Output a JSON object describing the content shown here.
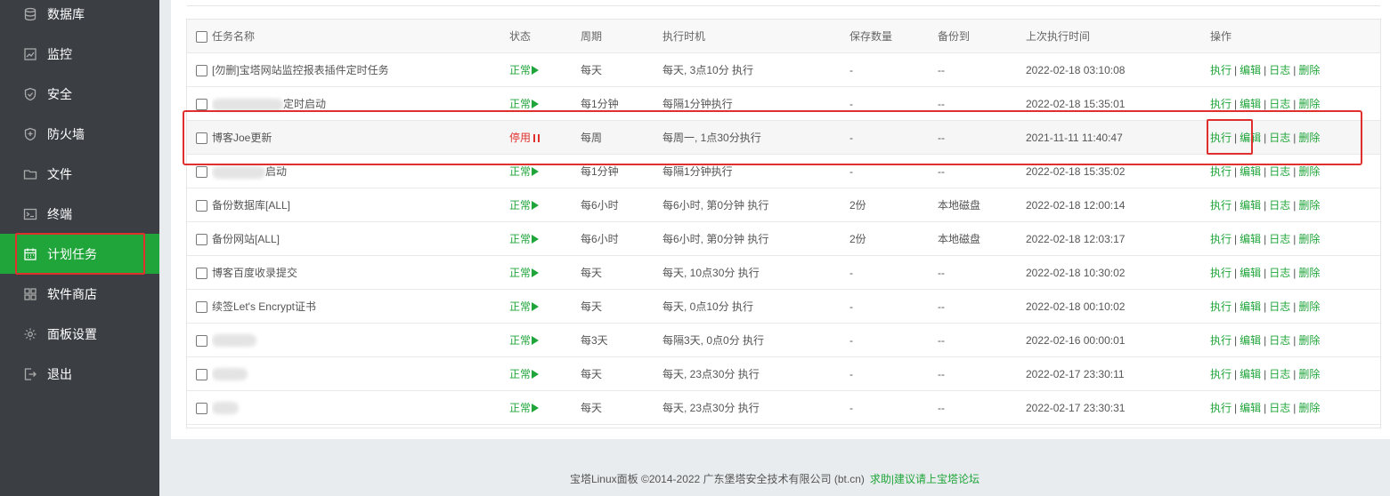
{
  "sidebar": {
    "items": [
      {
        "label": "数据库",
        "icon": "database-icon"
      },
      {
        "label": "监控",
        "icon": "monitor-icon"
      },
      {
        "label": "安全",
        "icon": "shield-icon"
      },
      {
        "label": "防火墙",
        "icon": "firewall-icon"
      },
      {
        "label": "文件",
        "icon": "folder-icon"
      },
      {
        "label": "终端",
        "icon": "terminal-icon"
      },
      {
        "label": "计划任务",
        "icon": "calendar-icon",
        "active": true
      },
      {
        "label": "软件商店",
        "icon": "apps-icon"
      },
      {
        "label": "面板设置",
        "icon": "gear-icon"
      },
      {
        "label": "退出",
        "icon": "logout-icon"
      }
    ]
  },
  "table": {
    "headers": {
      "name": "任务名称",
      "status": "状态",
      "cycle": "周期",
      "time": "执行时机",
      "keep": "保存数量",
      "backup": "备份到",
      "last": "上次执行时间",
      "ops": "操作"
    },
    "rows": [
      {
        "name": "[勿删]宝塔网站监控报表插件定时任务",
        "status": "正常",
        "cycle": "每天",
        "time": "每天, 3点10分 执行",
        "keep": "-",
        "backup": "--",
        "last": "2022-02-18 03:10:08"
      },
      {
        "name": "定时启动",
        "status": "正常",
        "cycle": "每1分钟",
        "time": "每隔1分钟执行",
        "keep": "-",
        "backup": "--",
        "last": "2022-02-18 15:35:01"
      },
      {
        "name": "博客Joe更新",
        "status": "停用",
        "cycle": "每周",
        "time": "每周一, 1点30分执行",
        "keep": "-",
        "backup": "--",
        "last": "2021-11-11 11:40:47"
      },
      {
        "name": "启动",
        "status": "正常",
        "cycle": "每1分钟",
        "time": "每隔1分钟执行",
        "keep": "-",
        "backup": "--",
        "last": "2022-02-18 15:35:02"
      },
      {
        "name": "备份数据库[ALL]",
        "status": "正常",
        "cycle": "每6小时",
        "time": "每6小时, 第0分钟 执行",
        "keep": "2份",
        "backup": "本地磁盘",
        "last": "2022-02-18 12:00:14"
      },
      {
        "name": "备份网站[ALL]",
        "status": "正常",
        "cycle": "每6小时",
        "time": "每6小时, 第0分钟 执行",
        "keep": "2份",
        "backup": "本地磁盘",
        "last": "2022-02-18 12:03:17"
      },
      {
        "name": "博客百度收录提交",
        "status": "正常",
        "cycle": "每天",
        "time": "每天, 10点30分 执行",
        "keep": "-",
        "backup": "--",
        "last": "2022-02-18 10:30:02"
      },
      {
        "name": "续签Let's Encrypt证书",
        "status": "正常",
        "cycle": "每天",
        "time": "每天, 0点10分 执行",
        "keep": "-",
        "backup": "--",
        "last": "2022-02-18 00:10:02"
      },
      {
        "name": "",
        "status": "正常",
        "cycle": "每3天",
        "time": "每隔3天, 0点0分 执行",
        "keep": "-",
        "backup": "--",
        "last": "2022-02-16 00:00:01"
      },
      {
        "name": "",
        "status": "正常",
        "cycle": "每天",
        "time": "每天, 23点30分 执行",
        "keep": "-",
        "backup": "--",
        "last": "2022-02-17 23:30:11"
      },
      {
        "name": "",
        "status": "正常",
        "cycle": "每天",
        "time": "每天, 23点30分 执行",
        "keep": "-",
        "backup": "--",
        "last": "2022-02-17 23:30:31"
      }
    ],
    "ops": {
      "run": "执行",
      "edit": "编辑",
      "log": "日志",
      "del": "删除"
    }
  },
  "footer": {
    "text": "宝塔Linux面板 ©2014-2022 广东堡塔安全技术有限公司 (bt.cn)",
    "link": "求助|建议请上宝塔论坛"
  },
  "colors": {
    "accent": "#20a53a",
    "danger": "#e0302d",
    "sidebar": "#3b3f44"
  }
}
